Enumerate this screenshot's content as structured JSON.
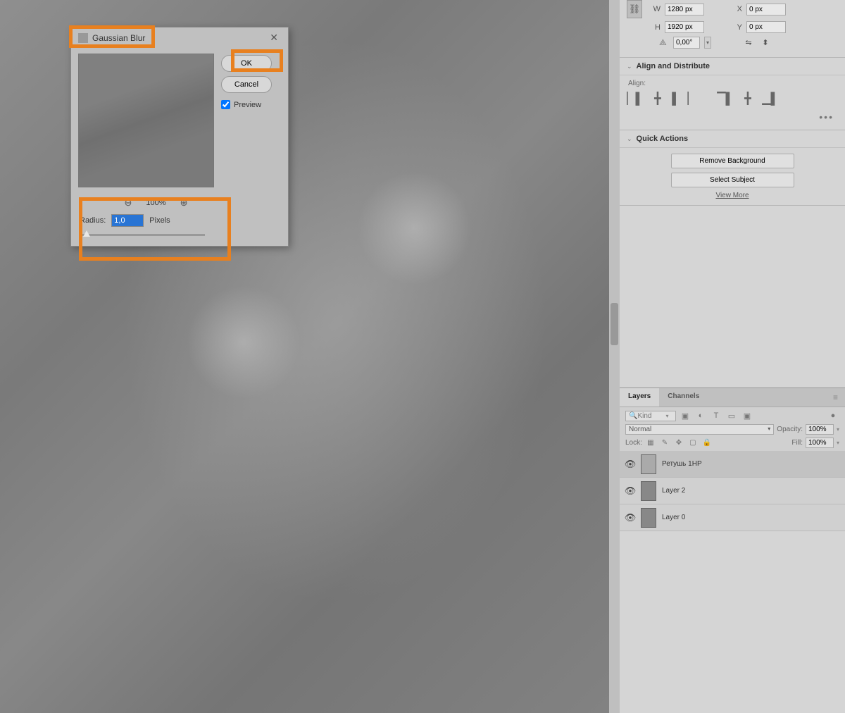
{
  "transform": {
    "w_label": "W",
    "w_value": "1280 px",
    "h_label": "H",
    "h_value": "1920 px",
    "x_label": "X",
    "x_value": "0 px",
    "y_label": "Y",
    "y_value": "0 px",
    "angle_value": "0,00°"
  },
  "align": {
    "section_title": "Align and Distribute",
    "label": "Align:"
  },
  "quick_actions": {
    "section_title": "Quick Actions",
    "remove_bg": "Remove Background",
    "select_subject": "Select Subject",
    "view_more": "View More"
  },
  "panels": {
    "layers_tab": "Layers",
    "channels_tab": "Channels"
  },
  "layers_controls": {
    "kind_placeholder": "Kind",
    "blend_mode": "Normal",
    "opacity_label": "Opacity:",
    "opacity_value": "100%",
    "lock_label": "Lock:",
    "fill_label": "Fill:",
    "fill_value": "100%"
  },
  "layers": [
    {
      "name": "Ретушь 1HP",
      "selected": true
    },
    {
      "name": "Layer 2",
      "selected": false
    },
    {
      "name": "Layer 0",
      "selected": false
    }
  ],
  "dialog": {
    "title": "Gaussian Blur",
    "ok": "OK",
    "cancel": "Cancel",
    "preview": "Preview",
    "zoom_pct": "100%",
    "radius_label": "Radius:",
    "radius_value": "1,0",
    "radius_unit": "Pixels"
  }
}
